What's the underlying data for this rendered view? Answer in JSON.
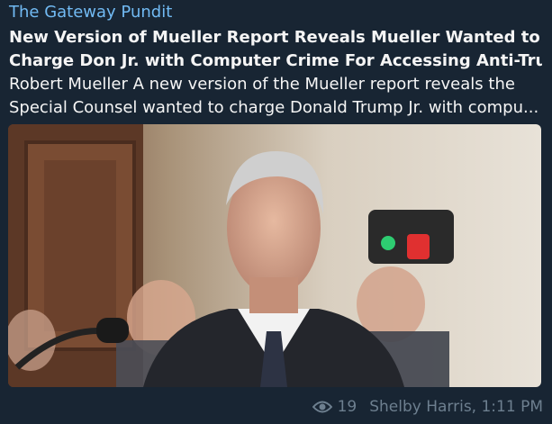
{
  "post": {
    "channel": "The Gateway Pundit",
    "headline_line1": "New Version of Mueller Report Reveals Mueller Wanted to",
    "headline_line2": "Charge Don Jr. with Computer Crime For Accessing Anti-Trump ...",
    "summary_line1": "Robert Mueller A new version of the Mueller report reveals the",
    "summary_line2": "Special Counsel wanted to charge Donald Trump Jr. with compu...",
    "views": "19",
    "author_time": "Shelby Harris, 1:11 PM"
  },
  "icons": {
    "views": "eye-icon"
  },
  "colors": {
    "background": "#182533",
    "channel": "#71baf3",
    "text": "#f5f5f5",
    "meta": "#6d7f8f"
  }
}
